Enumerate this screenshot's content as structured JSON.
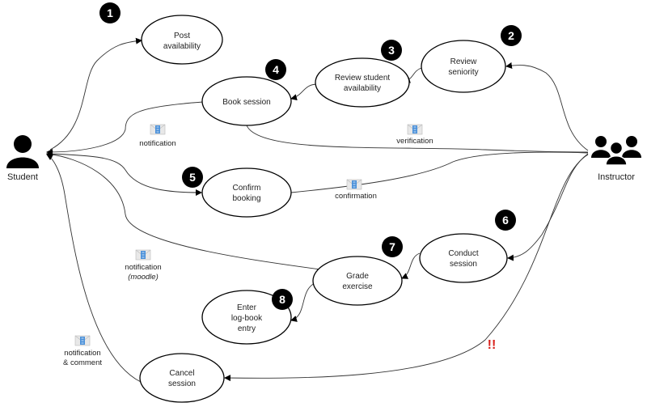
{
  "actors": {
    "student": {
      "label": "Student",
      "icon": "person-icon"
    },
    "instructor": {
      "label": "Instructor",
      "icon": "group-icon"
    }
  },
  "nodes": [
    {
      "number": "1",
      "lines": [
        "Post",
        "availability"
      ]
    },
    {
      "number": "2",
      "lines": [
        "Review",
        "seniority"
      ]
    },
    {
      "number": "3",
      "lines": [
        "Review student",
        "availability"
      ]
    },
    {
      "number": "4",
      "lines": [
        "Book session"
      ]
    },
    {
      "number": "5",
      "lines": [
        "Confirm",
        "booking"
      ]
    },
    {
      "number": "6",
      "lines": [
        "Conduct",
        "session"
      ]
    },
    {
      "number": "7",
      "lines": [
        "Grade",
        "exercise"
      ]
    },
    {
      "number": "8",
      "lines": [
        "Enter",
        "log-book",
        "entry"
      ]
    },
    {
      "number": "",
      "lines": [
        "Cancel",
        "session"
      ]
    }
  ],
  "messages": {
    "book_notification": "notification",
    "verification": "verification",
    "confirmation": "confirmation",
    "grade_notification": [
      "notification",
      "(moodle)"
    ],
    "cancel_notification": [
      "notification",
      "& comment"
    ]
  },
  "warning": "!!",
  "colors": {
    "badge": "#000000",
    "warning": "#d9231d",
    "envelope": "#4a90d9"
  }
}
